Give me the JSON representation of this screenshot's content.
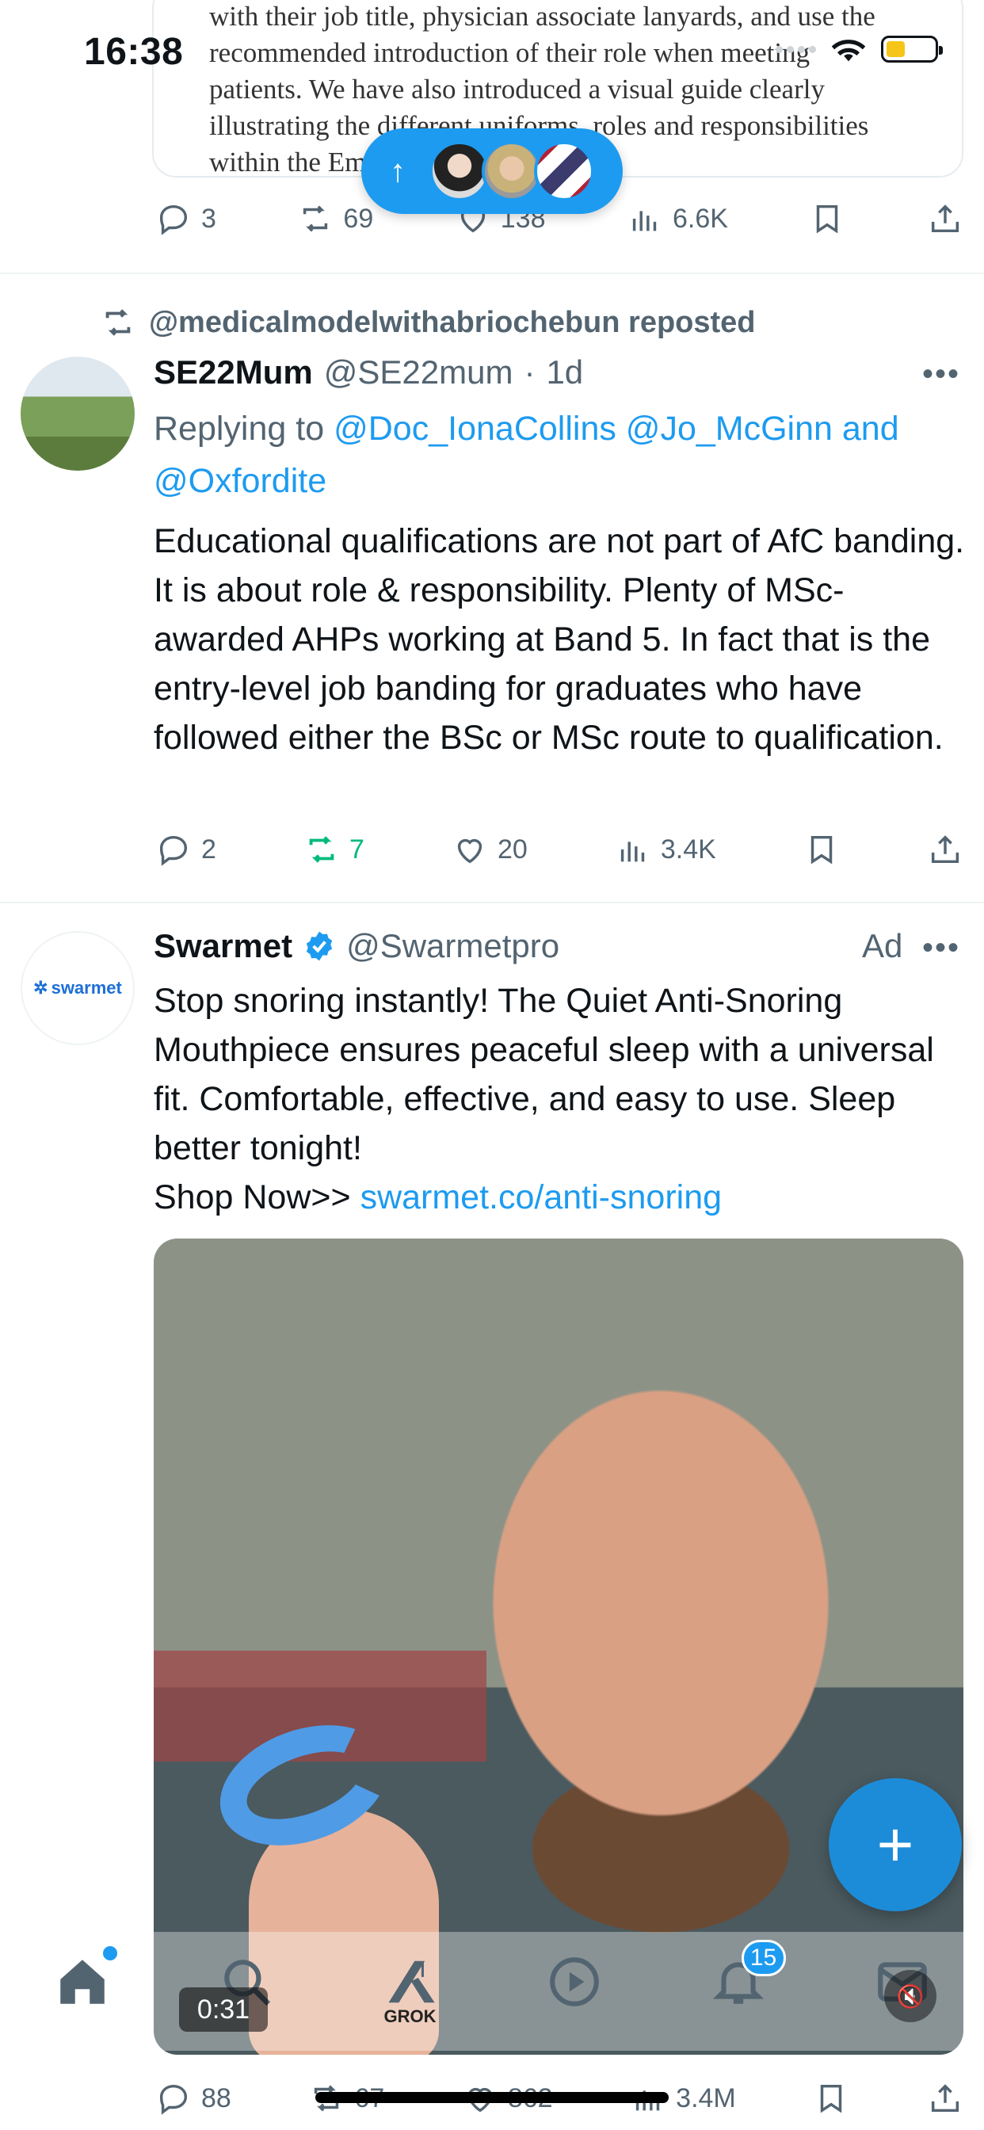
{
  "status_bar": {
    "time": "16:38"
  },
  "quoted_post": {
    "text": "with their job title, physician associate lanyards, and use the recommended introduction of their role when meeting patients. We have also introduced a visual guide clearly illustrating the different uniforms, roles and responsibilities within the Emergency Department.”"
  },
  "quoted_actions": {
    "replies": "3",
    "reposts": "69",
    "likes": "138",
    "views": "6.6K"
  },
  "post1": {
    "repost_by": "@medicalmodelwithabriochebun reposted",
    "name": "SE22Mum",
    "handle": "@SE22mum",
    "time": "1d",
    "replying_label": "Replying to",
    "replying_to": "@Doc_IonaCollins @Jo_McGinn and @Oxfordite",
    "text": "Educational qualifications are not part of AfC banding. It is about role & responsibility. Plenty of MSc-awarded AHPs working at Band 5. In fact that is the entry-level job banding for graduates who have followed either the BSc or MSc route to qualification.",
    "replies": "2",
    "reposts": "7",
    "likes": "20",
    "views": "3.4K"
  },
  "post2": {
    "avatar_text": "swarmet",
    "name": "Swarmet",
    "handle": "@Swarmetpro",
    "ad_label": "Ad",
    "text": "Stop snoring instantly! The Quiet Anti-Snoring Mouthpiece ensures peaceful sleep with a universal fit. Comfortable, effective, and easy to use. Sleep better tonight!",
    "shop_label": "Shop Now>>",
    "link": "swarmet.co/anti-snoring",
    "video_time": "0:31",
    "replies": "88",
    "reposts": "67",
    "likes": "862",
    "views": "3.4M"
  },
  "tab_bar": {
    "grok_label": "GROK",
    "notifications_count": "15"
  },
  "colors": {
    "accent": "#1d9bf0",
    "repost_active": "#00ba7c",
    "muted": "#536471"
  },
  "icons": [
    "reply-icon",
    "repost-icon",
    "like-icon",
    "views-icon",
    "bookmark-icon",
    "share-icon",
    "home-icon",
    "search-icon",
    "grok-icon",
    "video-icon",
    "bell-icon",
    "mail-icon",
    "verified-icon",
    "plus-icon"
  ]
}
